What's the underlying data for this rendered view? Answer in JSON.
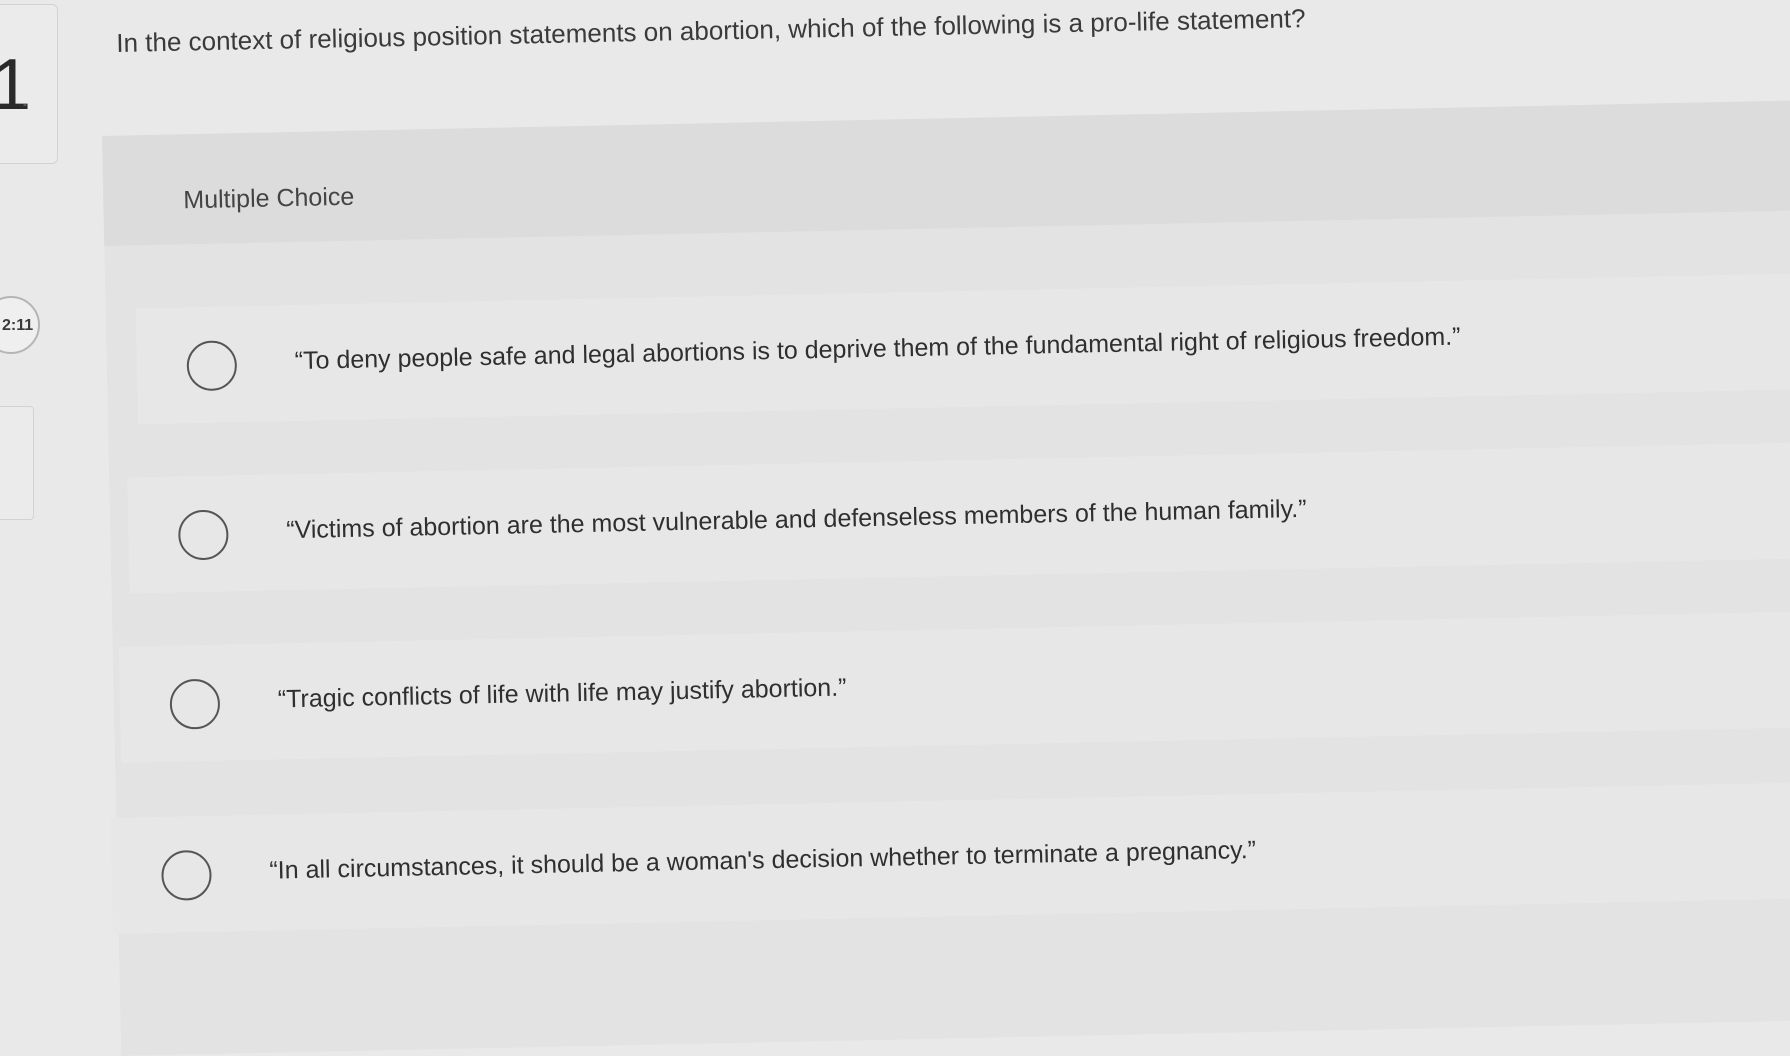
{
  "question": {
    "number": "1",
    "number_suffix": "-",
    "prompt": "In the context of religious position statements on abortion, which of the following is a pro-life statement?",
    "type_label": "Multiple Choice"
  },
  "timer": {
    "text": "2:11"
  },
  "choices": [
    {
      "label": "“To deny people safe and legal abortions is to deprive them of the fundamental right of religious freedom.”",
      "selected": false
    },
    {
      "label": "“Victims of abortion are the most vulnerable and defenseless members of the human family.”",
      "selected": false
    },
    {
      "label": "“Tragic conflicts of life with life may justify abortion.”",
      "selected": false
    },
    {
      "label": "“In all circumstances, it should be a woman's decision whether to terminate a pregnancy.”",
      "selected": false
    }
  ]
}
